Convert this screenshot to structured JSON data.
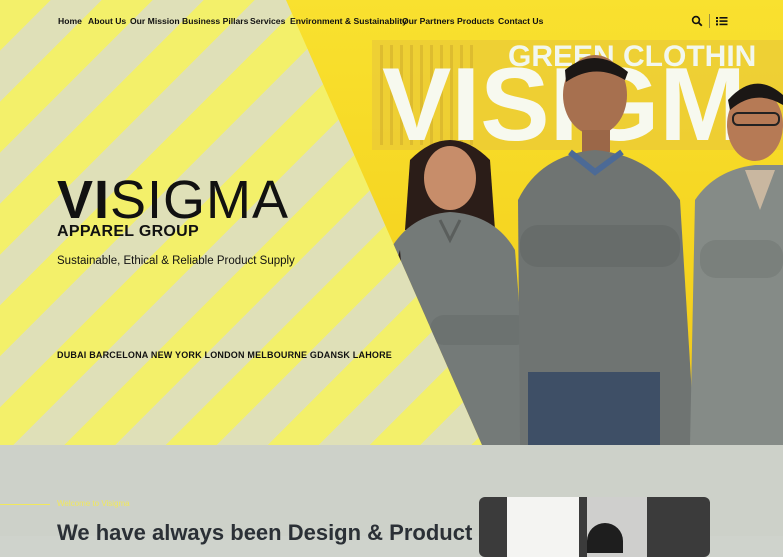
{
  "nav": {
    "links": [
      "Home",
      "About Us",
      "Our Mission",
      "Business Pillars",
      "Services",
      "Environment & Sustainablity",
      "Our Partners",
      "Products",
      "Contact Us"
    ],
    "icons": [
      "search-icon",
      "menu-list-icon"
    ]
  },
  "hero": {
    "brand_bold": "VI",
    "brand_light": "SIGMA",
    "brand_sub": "APPAREL GROUP",
    "tagline": "Sustainable, Ethical & Reliable Product Supply",
    "cities": "DUBAI BARCELONA NEW YORK LONDON MELBOURNE GDANSK LAHORE",
    "photo_sign_top": "GREEN CLOTHIN",
    "photo_sign_main": "VISIGM"
  },
  "section": {
    "welcome": "Welcome to Visigma",
    "headline": "We have always been Design & Product"
  },
  "colors": {
    "accent_yellow": "#f3f06a",
    "stripe_light": "#dfe0b8",
    "text_dark": "#111111",
    "section_bg": "#cdd1c9"
  }
}
